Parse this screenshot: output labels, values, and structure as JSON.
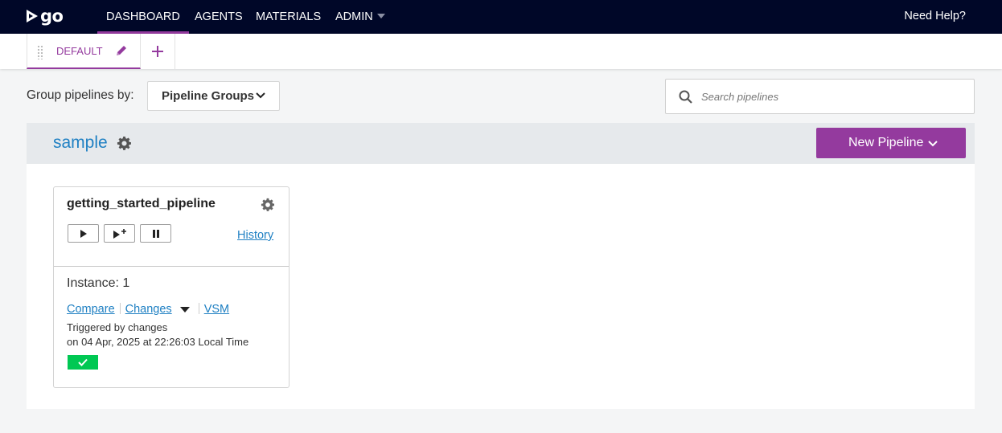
{
  "topnav": {
    "logo_text": "go",
    "items": [
      {
        "label": "DASHBOARD"
      },
      {
        "label": "AGENTS"
      },
      {
        "label": "MATERIALS"
      },
      {
        "label": "ADMIN"
      }
    ],
    "help": "Need Help?"
  },
  "tabs": {
    "items": [
      {
        "label": "DEFAULT"
      }
    ]
  },
  "toolbar": {
    "group_by_label": "Group pipelines by:",
    "group_by_value": "Pipeline Groups",
    "search_placeholder": "Search pipelines"
  },
  "group": {
    "name": "sample",
    "new_pipeline_label": "New Pipeline",
    "pipelines": [
      {
        "name": "getting_started_pipeline",
        "history_label": "History",
        "instance_label": "Instance: 1",
        "compare_label": "Compare",
        "changes_label": "Changes",
        "vsm_label": "VSM",
        "triggered_by": "Triggered by changes",
        "triggered_on": "on 04 Apr, 2025 at 22:26:03 Local Time",
        "stage_status": "passed"
      }
    ]
  },
  "colors": {
    "nav_bg": "#000728",
    "accent": "#943a9e",
    "link": "#1f80c3",
    "stage_passed": "#00c853"
  }
}
